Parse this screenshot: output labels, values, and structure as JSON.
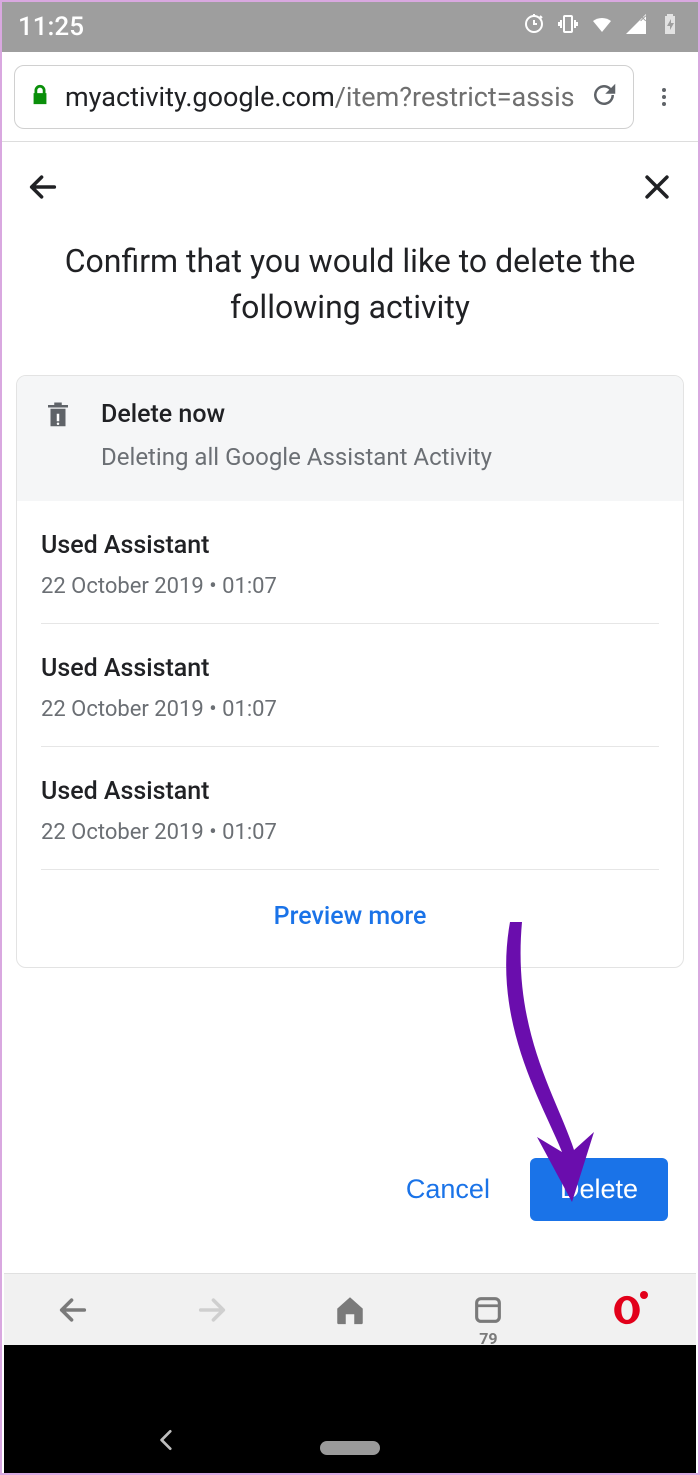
{
  "status_bar": {
    "time": "11:25"
  },
  "browser": {
    "url_host": "myactivity.google.com",
    "url_rest": "/item?restrict=assis"
  },
  "page": {
    "title": "Confirm that you would like to delete the following activity",
    "delete_header": "Delete now",
    "delete_subheader": "Deleting all Google Assistant Activity",
    "activities": [
      {
        "title": "Used Assistant",
        "timestamp": "22 October 2019 • 01:07"
      },
      {
        "title": "Used Assistant",
        "timestamp": "22 October 2019 • 01:07"
      },
      {
        "title": "Used Assistant",
        "timestamp": "22 October 2019 • 01:07"
      }
    ],
    "preview_more": "Preview more",
    "cancel": "Cancel",
    "delete": "Delete"
  },
  "bottom_nav": {
    "tab_count": "79"
  },
  "colors": {
    "accent": "#1a73e8",
    "arrow": "#6a0dad"
  }
}
